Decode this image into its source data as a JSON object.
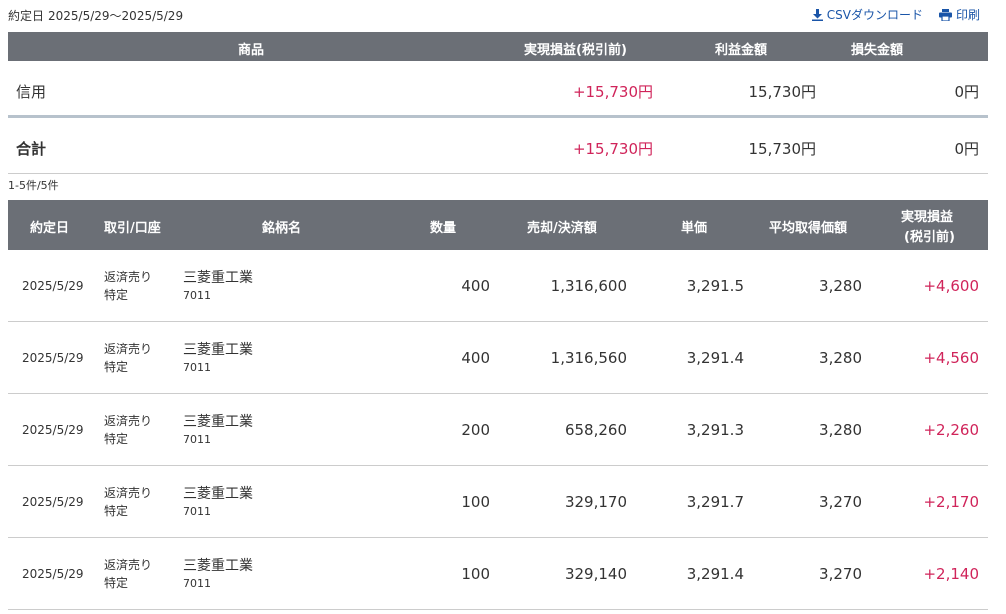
{
  "header": {
    "period_label": "約定日",
    "period_value": "2025/5/29～2025/5/29",
    "csv_label": "CSVダウンロード",
    "print_label": "印刷"
  },
  "summary": {
    "columns": [
      "商品",
      "実現損益(税引前)",
      "利益金額",
      "損失金額"
    ],
    "rows": [
      {
        "label": "信用",
        "realized": "+15,730円",
        "profit": "15,730円",
        "loss": "0円"
      }
    ],
    "total": {
      "label": "合計",
      "realized": "+15,730円",
      "profit": "15,730円",
      "loss": "0円"
    }
  },
  "count_text": "1-5件/5件",
  "detail": {
    "columns": {
      "date": "約定日",
      "type": "取引/口座",
      "name": "銘柄名",
      "qty": "数量",
      "amount": "売却/決済額",
      "price": "単価",
      "avg": "平均取得価額",
      "pl_line1": "実現損益",
      "pl_line2": "(税引前)"
    },
    "rows": [
      {
        "date": "2025/5/29",
        "trade": "返済売り",
        "account": "特定",
        "name": "三菱重工業",
        "code": "7011",
        "qty": "400",
        "amount": "1,316,600",
        "price": "3,291.5",
        "avg": "3,280",
        "pl": "+4,600"
      },
      {
        "date": "2025/5/29",
        "trade": "返済売り",
        "account": "特定",
        "name": "三菱重工業",
        "code": "7011",
        "qty": "400",
        "amount": "1,316,560",
        "price": "3,291.4",
        "avg": "3,280",
        "pl": "+4,560"
      },
      {
        "date": "2025/5/29",
        "trade": "返済売り",
        "account": "特定",
        "name": "三菱重工業",
        "code": "7011",
        "qty": "200",
        "amount": "658,260",
        "price": "3,291.3",
        "avg": "3,280",
        "pl": "+2,260"
      },
      {
        "date": "2025/5/29",
        "trade": "返済売り",
        "account": "特定",
        "name": "三菱重工業",
        "code": "7011",
        "qty": "100",
        "amount": "329,170",
        "price": "3,291.7",
        "avg": "3,270",
        "pl": "+2,170"
      },
      {
        "date": "2025/5/29",
        "trade": "返済売り",
        "account": "特定",
        "name": "三菱重工業",
        "code": "7011",
        "qty": "100",
        "amount": "329,140",
        "price": "3,291.4",
        "avg": "3,270",
        "pl": "+2,140"
      }
    ]
  },
  "colors": {
    "header_bg": "#6b6f76",
    "positive": "#d0245a",
    "link": "#1a55a8"
  },
  "icons": {
    "csv": "download-icon",
    "print": "printer-icon"
  }
}
